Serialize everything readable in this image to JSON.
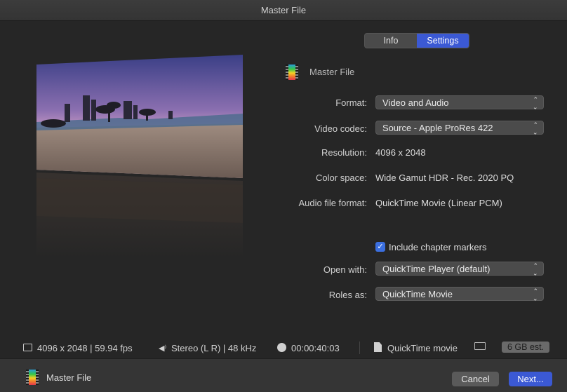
{
  "window": {
    "title": "Master File"
  },
  "tabs": [
    {
      "label": "Info",
      "active": false
    },
    {
      "label": "Settings",
      "active": true
    }
  ],
  "header": {
    "name": "Master File",
    "icon": "film-icon"
  },
  "settings": {
    "format": {
      "label": "Format:",
      "value": "Video and Audio"
    },
    "video_codec": {
      "label": "Video codec:",
      "value": "Source - Apple ProRes 422"
    },
    "resolution": {
      "label": "Resolution:",
      "value": "4096 x 2048"
    },
    "color_space": {
      "label": "Color space:",
      "value": "Wide Gamut HDR - Rec. 2020 PQ"
    },
    "audio_file_format": {
      "label": "Audio file format:",
      "value": "QuickTime Movie (Linear PCM)"
    },
    "chapter_markers": {
      "label": "Include chapter markers",
      "checked": true
    },
    "open_with": {
      "label": "Open with:",
      "value": "QuickTime Player (default)"
    },
    "roles_as": {
      "label": "Roles as:",
      "value": "QuickTime Movie"
    }
  },
  "status": {
    "video": "4096 x 2048 | 59.94 fps",
    "audio": "Stereo (L R) | 48 kHz",
    "duration": "00:00:40:03",
    "file_type": "QuickTime movie",
    "size_estimate": "6 GB est."
  },
  "footer": {
    "name": "Master File",
    "cancel_label": "Cancel",
    "next_label": "Next..."
  },
  "colors": {
    "accent": "#3b59d4",
    "background": "#262626"
  }
}
